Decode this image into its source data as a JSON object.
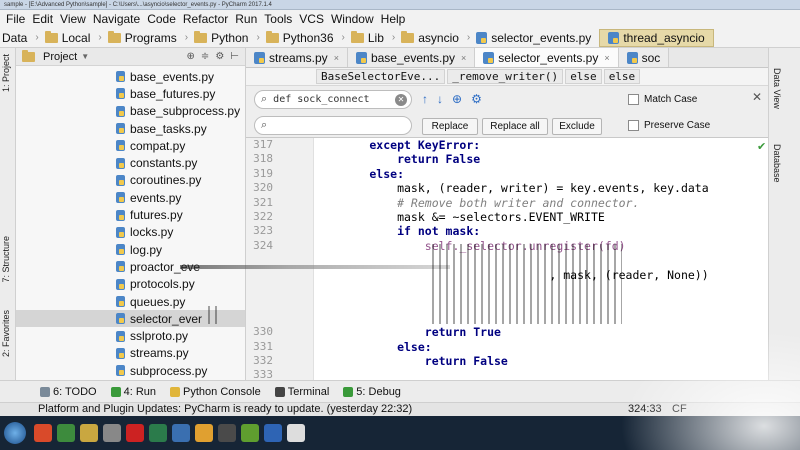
{
  "titlebar": {
    "text": "sample - [E:\\Advanced Python\\sample] - C:\\Users\\...\\asyncio\\selector_events.py - PyCharm 2017.1.4"
  },
  "menu": [
    "File",
    "Edit",
    "View",
    "Navigate",
    "Code",
    "Refactor",
    "Run",
    "Tools",
    "VCS",
    "Window",
    "Help"
  ],
  "nav": {
    "crumbs": [
      "Data",
      "Local",
      "Programs",
      "Python",
      "Python36",
      "Lib",
      "asyncio"
    ],
    "file": "selector_events.py",
    "active": "thread_asyncio"
  },
  "left_tabs": {
    "project": "1: Project",
    "structure": "7: Structure",
    "favorites": "2: Favorites"
  },
  "right_tabs": {
    "sciview": "Data View",
    "database": "Database"
  },
  "project_panel": {
    "title": "Project",
    "tools": [
      "⊕",
      "≑",
      "⚙",
      "⊢"
    ],
    "files": [
      "base_events.py",
      "base_futures.py",
      "base_subprocess.py",
      "base_tasks.py",
      "compat.py",
      "constants.py",
      "coroutines.py",
      "events.py",
      "futures.py",
      "locks.py",
      "log.py",
      "proactor_eve",
      "protocols.py",
      "queues.py",
      "selector_ever",
      "sslproto.py",
      "streams.py",
      "subprocess.py"
    ],
    "selected_index": 14
  },
  "editor_tabs": [
    {
      "label": "streams.py",
      "active": false
    },
    {
      "label": "base_events.py",
      "active": false
    },
    {
      "label": "selector_events.py",
      "active": true
    },
    {
      "label": "soc",
      "active": false
    }
  ],
  "code_breadcrumb": [
    "BaseSelectorEve...",
    "_remove_writer()",
    "else",
    "else"
  ],
  "find": {
    "search_value": "def sock_connect",
    "replace_value": "",
    "buttons": {
      "replace": "Replace",
      "replace_all": "Replace all",
      "exclude": "Exclude"
    },
    "options": {
      "match_case": "Match Case",
      "preserve_case": "Preserve Case"
    },
    "icons": [
      "↑",
      "↓",
      "⊕",
      "⚙"
    ]
  },
  "code": {
    "line_numbers": [
      "317",
      "318",
      "319",
      "320",
      "321",
      "322",
      "323",
      "324",
      "",
      "",
      "",
      "",
      "",
      "330",
      "331",
      "332",
      "333"
    ],
    "lines": [
      {
        "text": "        except KeyError:",
        "cls": "kw"
      },
      {
        "text": "            return False",
        "cls": "kw"
      },
      {
        "text": "        else:",
        "cls": "kw"
      },
      {
        "text": "            mask, (reader, writer) = key.events, key.data",
        "cls": ""
      },
      {
        "text": "            # Remove both writer and connector.",
        "cls": "cm"
      },
      {
        "text": "            mask &= ~selectors.EVENT_WRITE",
        "cls": ""
      },
      {
        "text": "            if not mask:",
        "cls": "kw"
      },
      {
        "text": "                self._selector.unregister(fd)",
        "cls": "self"
      },
      {
        "text": "",
        "cls": ""
      },
      {
        "text": "                                  , mask, (reader, None))",
        "cls": ""
      },
      {
        "text": "",
        "cls": ""
      },
      {
        "text": "",
        "cls": ""
      },
      {
        "text": "",
        "cls": ""
      },
      {
        "text": "                return True",
        "cls": "kw"
      },
      {
        "text": "            else:",
        "cls": "kw"
      },
      {
        "text": "                return False",
        "cls": "kw"
      },
      {
        "text": "",
        "cls": ""
      }
    ]
  },
  "bottom_tools": [
    "6: TODO",
    "4: Run",
    "Python Console",
    "Terminal",
    "5: Debug"
  ],
  "status": {
    "message": "Platform and Plugin Updates: PyCharm is ready to update. (yesterday 22:32)",
    "position": "324:33",
    "encoding": "CF"
  },
  "colors": {
    "keyword": "#000080",
    "comment": "#808080",
    "accent": "#2c6cc4",
    "taskbar": "#162536"
  }
}
